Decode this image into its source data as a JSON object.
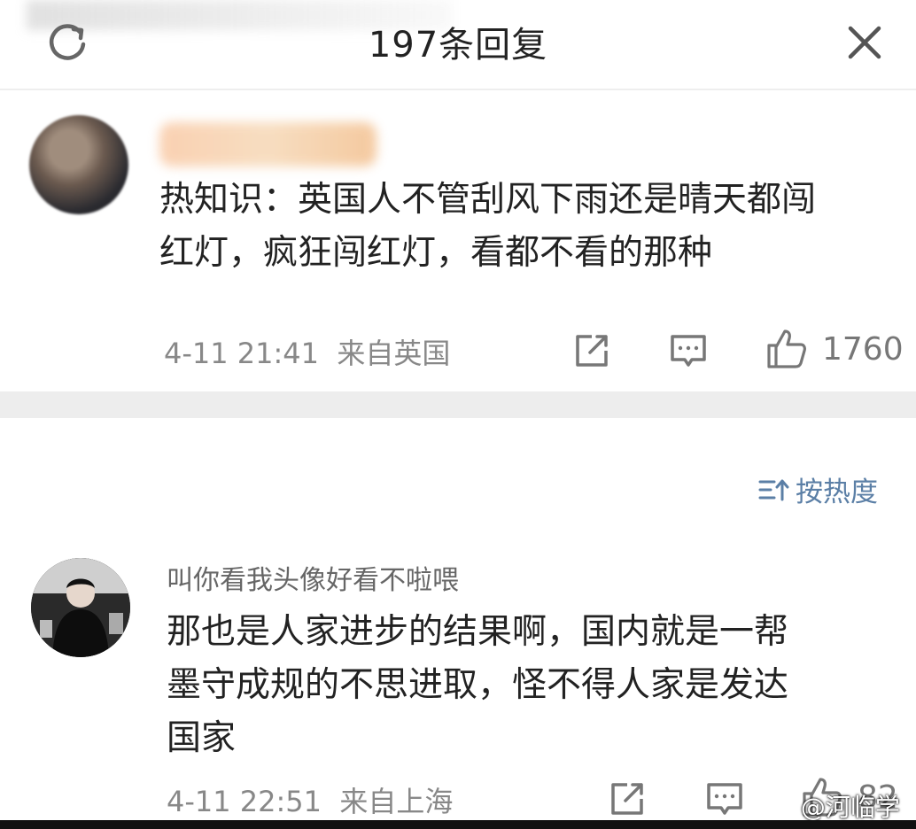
{
  "header": {
    "title": "197条回复",
    "refresh_icon": "refresh-icon",
    "close_icon": "close-icon"
  },
  "comments": [
    {
      "text": "热知识：英国人不管刮风下雨还是晴天都闯\n红灯，疯狂闯红灯，看都不看的那种",
      "time": "4-11 21:41",
      "location": "来自英国",
      "likes": "1760"
    },
    {
      "username": "叫你看我头像好看不啦喂",
      "text": "那也是人家进步的结果啊，国内就是一帮\n墨守成规的不思进取，怪不得人家是发达\n国家",
      "time": "4-11 22:51",
      "location": "来自上海",
      "likes": "82"
    }
  ],
  "sort": {
    "label": "按热度",
    "icon": "sort-icon"
  },
  "watermark": {
    "text": "@河临学宫",
    "icon": "weibo-icon"
  },
  "colors": {
    "accent": "#5b7fa6",
    "meta": "#888888",
    "divider": "#ededed"
  }
}
